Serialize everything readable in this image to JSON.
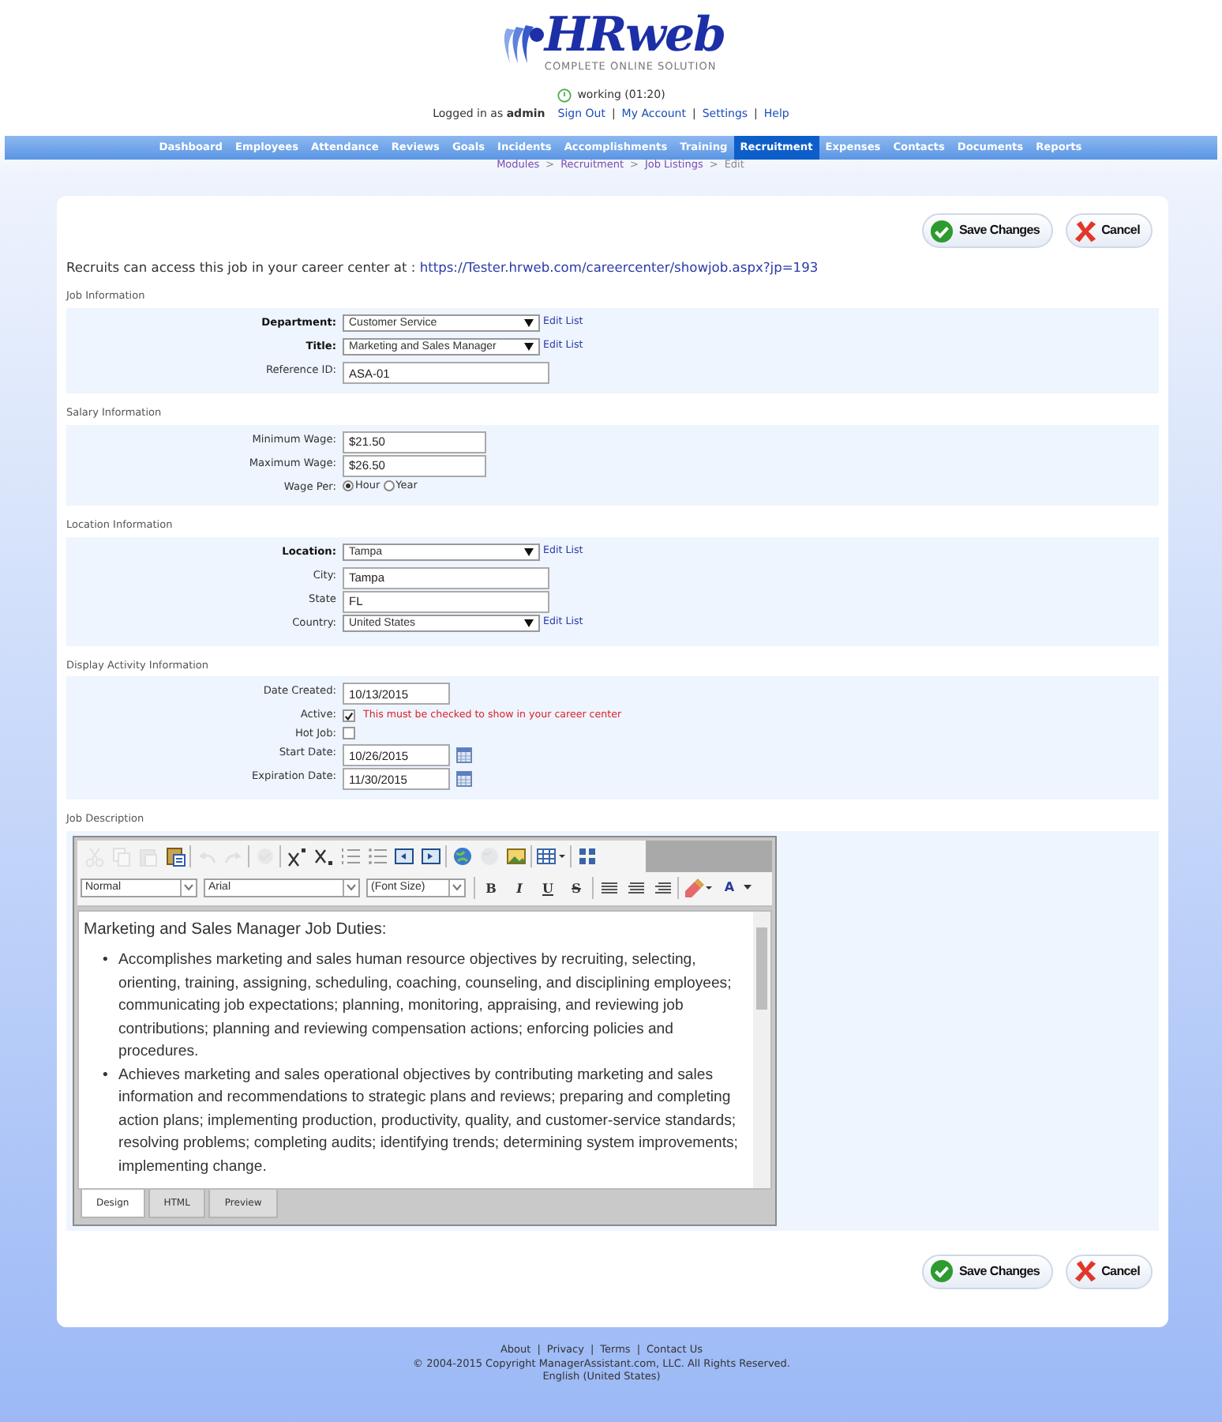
{
  "header": {
    "logo": {
      "name": "HRweb",
      "tagline": "COMPLETE ONLINE SOLUTION"
    },
    "status": "working (01:20)",
    "login_prefix": "Logged in as",
    "user": "admin",
    "links": [
      "Sign Out",
      "My Account",
      "Settings",
      "Help"
    ],
    "link_separator": "|"
  },
  "nav": [
    {
      "label": "Dashboard",
      "selected": false
    },
    {
      "label": "Employees",
      "selected": false
    },
    {
      "label": "Attendance",
      "selected": false
    },
    {
      "label": "Reviews",
      "selected": false
    },
    {
      "label": "Goals",
      "selected": false
    },
    {
      "label": "Incidents",
      "selected": false
    },
    {
      "label": "Accomplishments",
      "selected": false
    },
    {
      "label": "Training",
      "selected": false
    },
    {
      "label": "Recruitment",
      "selected": true
    },
    {
      "label": "Expenses",
      "selected": false
    },
    {
      "label": "Contacts",
      "selected": false
    },
    {
      "label": "Documents",
      "selected": false
    },
    {
      "label": "Reports",
      "selected": false
    }
  ],
  "breadcrumb": {
    "items": [
      "Modules",
      "Recruitment",
      "Job Listings",
      "Edit"
    ],
    "separator": ">"
  },
  "top_buttons": [
    {
      "kind": "save",
      "label": "Save Changes"
    },
    {
      "kind": "cancel",
      "label": "Cancel"
    }
  ],
  "career_note": {
    "text": "Recruits can access this job in your career center at :",
    "url": "https://Tester.hrweb.com/careercenter/showjob.aspx?jp=193"
  },
  "sections": [
    {
      "title": "Job Information",
      "fields": [
        {
          "kind": "select",
          "label": "Department:",
          "required": true,
          "value": "Customer Service",
          "edit_link": "Edit List"
        },
        {
          "kind": "select",
          "label": "Title:",
          "required": true,
          "value": "Marketing and Sales Manager",
          "edit_link": "Edit List"
        },
        {
          "kind": "text",
          "label": "Reference ID:",
          "required": false,
          "value": "ASA-01"
        }
      ]
    },
    {
      "title": "Salary Information",
      "fields": [
        {
          "kind": "amount",
          "label": "Minimum Wage:",
          "required": false,
          "value": "$21.50"
        },
        {
          "kind": "amount",
          "label": "Maximum Wage:",
          "required": false,
          "value": "$26.50"
        },
        {
          "kind": "radio",
          "label": "Wage Per:",
          "required": false,
          "options": [
            {
              "label": "Hour",
              "selected": true
            },
            {
              "label": "Year",
              "selected": false
            }
          ]
        }
      ]
    },
    {
      "title": "Location Information",
      "fields": [
        {
          "kind": "select",
          "label": "Location:",
          "required": true,
          "value": "Tampa",
          "edit_link": "Edit List"
        },
        {
          "kind": "text",
          "label": "City:",
          "required": false,
          "value": "Tampa"
        },
        {
          "kind": "text",
          "label": "State",
          "required": false,
          "value": "FL"
        },
        {
          "kind": "select",
          "label": "Country:",
          "required": false,
          "value": "United States",
          "edit_link": "Edit List"
        }
      ]
    },
    {
      "title": "Display Activity Information",
      "fields": [
        {
          "kind": "date",
          "label": "Date Created:",
          "required": false,
          "value": "10/13/2015",
          "calendar": false
        },
        {
          "kind": "checkbox",
          "label": "Active:",
          "required": false,
          "checked": true,
          "note": "This must be checked to show in your career center"
        },
        {
          "kind": "checkbox",
          "label": "Hot Job:",
          "required": false,
          "checked": false
        },
        {
          "kind": "date",
          "label": "Start Date:",
          "required": false,
          "value": "10/26/2015",
          "calendar": true
        },
        {
          "kind": "date",
          "label": "Expiration Date:",
          "required": false,
          "value": "11/30/2015",
          "calendar": true
        }
      ]
    }
  ],
  "job_description": {
    "title": "Job Description",
    "toolbar": [
      {
        "kind": "cut",
        "disabled": true
      },
      {
        "kind": "copy",
        "disabled": true
      },
      {
        "kind": "paste",
        "disabled": true
      },
      {
        "kind": "paste-text",
        "disabled": false
      },
      {
        "kind": "sep"
      },
      {
        "kind": "undo",
        "disabled": true
      },
      {
        "kind": "redo",
        "disabled": true
      },
      {
        "kind": "sep"
      },
      {
        "kind": "spell",
        "disabled": true
      },
      {
        "kind": "sep"
      },
      {
        "kind": "superscript",
        "disabled": false
      },
      {
        "kind": "subscript",
        "disabled": false
      },
      {
        "kind": "ordered-list",
        "disabled": false
      },
      {
        "kind": "bullet-list",
        "disabled": false
      },
      {
        "kind": "outdent",
        "disabled": false
      },
      {
        "kind": "indent",
        "disabled": false
      },
      {
        "kind": "sep"
      },
      {
        "kind": "link",
        "disabled": false
      },
      {
        "kind": "unlink",
        "disabled": true
      },
      {
        "kind": "image",
        "disabled": false
      },
      {
        "kind": "sep"
      },
      {
        "kind": "table",
        "disabled": false
      },
      {
        "kind": "sep"
      },
      {
        "kind": "grid",
        "disabled": false
      }
    ],
    "format": {
      "style": "Normal",
      "font": "Arial",
      "size": "(Font Size)"
    },
    "format_buttons": [
      {
        "kind": "bold",
        "label": "B"
      },
      {
        "kind": "italic",
        "label": "I"
      },
      {
        "kind": "underline",
        "label": "U"
      },
      {
        "kind": "strike",
        "label": "S"
      }
    ],
    "color_button": {
      "label": "A"
    },
    "heading": "Marketing and Sales Manager Job Duties:",
    "bullets": [
      {
        "marker": "•",
        "text": "Accomplishes marketing and sales human resource objectives by recruiting, selecting, orienting, training, assigning, scheduling, coaching, counseling, and disciplining employees; communicating job expectations; planning, monitoring, appraising, and reviewing job contributions; planning and reviewing compensation actions; enforcing policies and procedures."
      },
      {
        "marker": "•",
        "text": "Achieves marketing and sales operational objectives by contributing marketing and sales information and recommendations to strategic plans and reviews; preparing and completing action plans; implementing production, productivity, quality, and customer-service standards; resolving problems; completing audits; identifying trends; determining system improvements; implementing change."
      }
    ],
    "tabs": [
      {
        "label": "Design",
        "selected": true
      },
      {
        "label": "HTML",
        "selected": false
      },
      {
        "label": "Preview",
        "selected": false
      }
    ]
  },
  "bottom_buttons": [
    {
      "kind": "save",
      "label": "Save Changes"
    },
    {
      "kind": "cancel",
      "label": "Cancel"
    }
  ],
  "footer": {
    "links": [
      "About",
      "Privacy",
      "Terms",
      "Contact Us"
    ],
    "separator": "|",
    "copyright": "© 2004-2015 Copyright ManagerAssistant.com, LLC. All Rights Reserved.",
    "language": "English (United States)"
  }
}
